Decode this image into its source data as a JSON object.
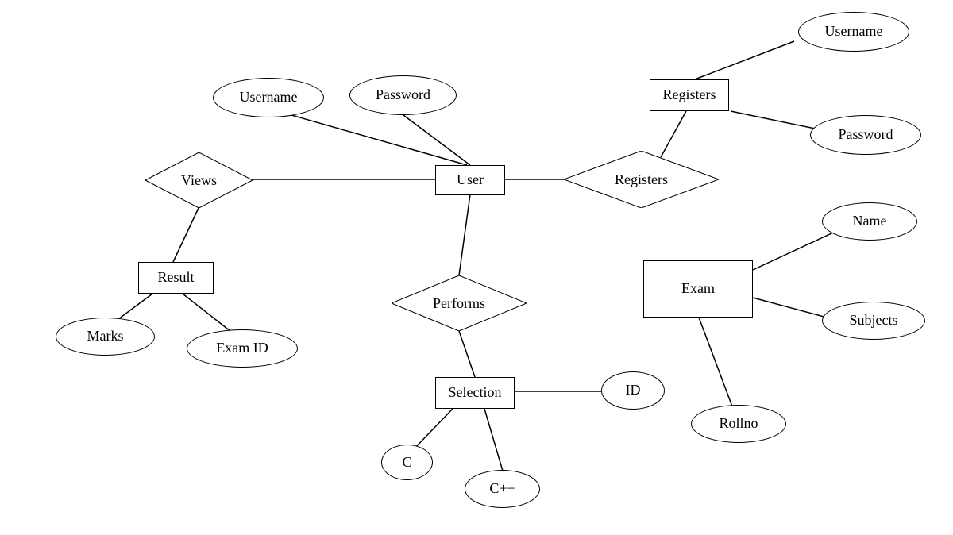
{
  "entities": {
    "user": "User",
    "result": "Result",
    "selection": "Selection",
    "exam": "Exam",
    "registers_entity": "Registers"
  },
  "relationships": {
    "views": "Views",
    "performs": "Performs",
    "registers_rel": "Registers"
  },
  "attributes": {
    "user_username": "Username",
    "user_password": "Password",
    "reg_username": "Username",
    "reg_password": "Password",
    "result_marks": "Marks",
    "result_examid": "Exam ID",
    "sel_id": "ID",
    "sel_c": "C",
    "sel_cpp": "C++",
    "exam_name": "Name",
    "exam_subjects": "Subjects",
    "exam_rollno": "Rollno"
  }
}
